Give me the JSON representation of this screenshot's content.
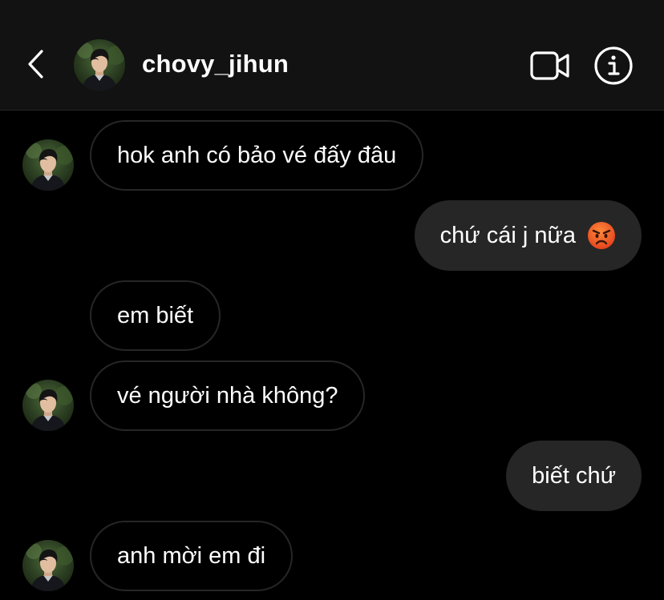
{
  "header": {
    "username": "chovy_jihun",
    "back_icon": "chevron-left-icon",
    "video_icon": "video-camera-icon",
    "info_icon": "info-icon"
  },
  "messages": [
    {
      "side": "incoming",
      "text": "hok anh có bảo vé đấy đâu",
      "avatar_shown": true
    },
    {
      "side": "outgoing",
      "text": "chứ cái j nữa",
      "emoji": "angry-face-icon"
    },
    {
      "side": "incoming",
      "text": "em biết",
      "avatar_shown": false
    },
    {
      "side": "incoming",
      "text": "vé người nhà không?",
      "avatar_shown": true
    },
    {
      "side": "outgoing",
      "text": "biết chứ"
    },
    {
      "side": "incoming",
      "text": "anh mời em đi",
      "avatar_shown": true
    }
  ],
  "colors": {
    "header_bg": "#121212",
    "page_bg": "#000000",
    "outgoing_bubble": "#262626",
    "incoming_border": "#262626",
    "text": "#ffffff"
  }
}
